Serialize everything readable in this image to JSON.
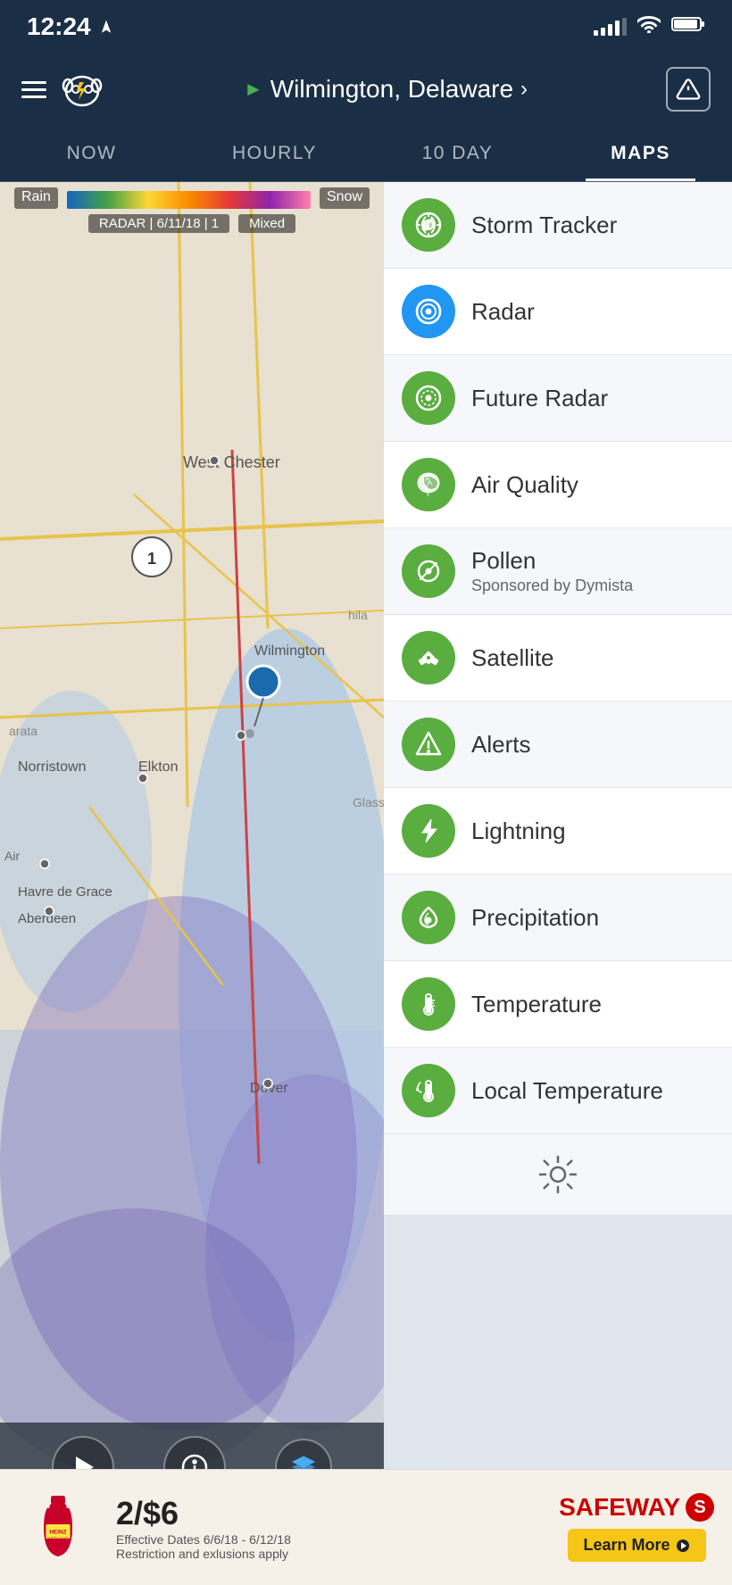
{
  "statusBar": {
    "time": "12:24",
    "signals": 4
  },
  "header": {
    "location": "Wilmington, Delaware",
    "alertLabel": "!"
  },
  "navTabs": [
    {
      "label": "NOW",
      "active": false
    },
    {
      "label": "HOURLY",
      "active": false
    },
    {
      "label": "10 DAY",
      "active": false
    },
    {
      "label": "MAPS",
      "active": true
    }
  ],
  "radarLegend": {
    "leftLabel": "Rain",
    "rightLabel": "Snow",
    "middleLabel": "Mixed",
    "dateLabel": "RADAR | 6/11/18 | 1"
  },
  "menuItems": [
    {
      "id": "storm-tracker",
      "label": "Storm Tracker",
      "sublabel": "",
      "iconType": "storm"
    },
    {
      "id": "radar",
      "label": "Radar",
      "sublabel": "",
      "iconType": "radar"
    },
    {
      "id": "future-radar",
      "label": "Future Radar",
      "sublabel": "",
      "iconType": "future-radar"
    },
    {
      "id": "air-quality",
      "label": "Air Quality",
      "sublabel": "",
      "iconType": "air-quality"
    },
    {
      "id": "pollen",
      "label": "Pollen",
      "sublabel": "Sponsored by Dymista",
      "iconType": "pollen"
    },
    {
      "id": "satellite",
      "label": "Satellite",
      "sublabel": "",
      "iconType": "satellite"
    },
    {
      "id": "alerts",
      "label": "Alerts",
      "sublabel": "",
      "iconType": "alerts"
    },
    {
      "id": "lightning",
      "label": "Lightning",
      "sublabel": "",
      "iconType": "lightning"
    },
    {
      "id": "precipitation",
      "label": "Precipitation",
      "sublabel": "",
      "iconType": "precipitation"
    },
    {
      "id": "temperature",
      "label": "Temperature",
      "sublabel": "",
      "iconType": "temperature"
    },
    {
      "id": "local-temperature",
      "label": "Local Temperature",
      "sublabel": "",
      "iconType": "local-temp"
    }
  ],
  "mapControls": {
    "playLabel": "▶",
    "infoLabel": "ℹ",
    "layersLabel": "layers"
  },
  "adBanner": {
    "price": "2/$6",
    "storeName": "SAFEWAY",
    "dateRange": "Effective Dates 6/6/18 - 6/12/18",
    "disclaimer": "Restriction and exlusions apply",
    "learnMore": "Learn More"
  },
  "homeIndicator": ""
}
